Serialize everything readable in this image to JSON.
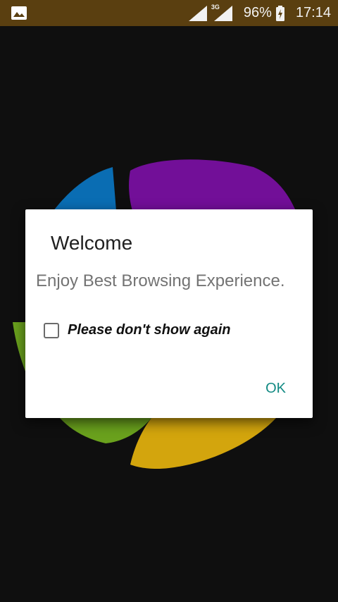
{
  "status_bar": {
    "network_label": "3G",
    "battery_percent": "96%",
    "time": "17:14",
    "color": "#5a3f10"
  },
  "dialog": {
    "title": "Welcome",
    "message": "Enjoy Best Browsing Experience.",
    "checkbox": {
      "label": "Please don't show again",
      "checked": false
    },
    "ok_label": "OK",
    "accent_color": "#128a83"
  },
  "logo_colors": {
    "blue": "#0a78c5",
    "purple": "#7b0fa4",
    "red": "#c6160f",
    "yellow": "#e4b20d",
    "green": "#6aa11d"
  }
}
